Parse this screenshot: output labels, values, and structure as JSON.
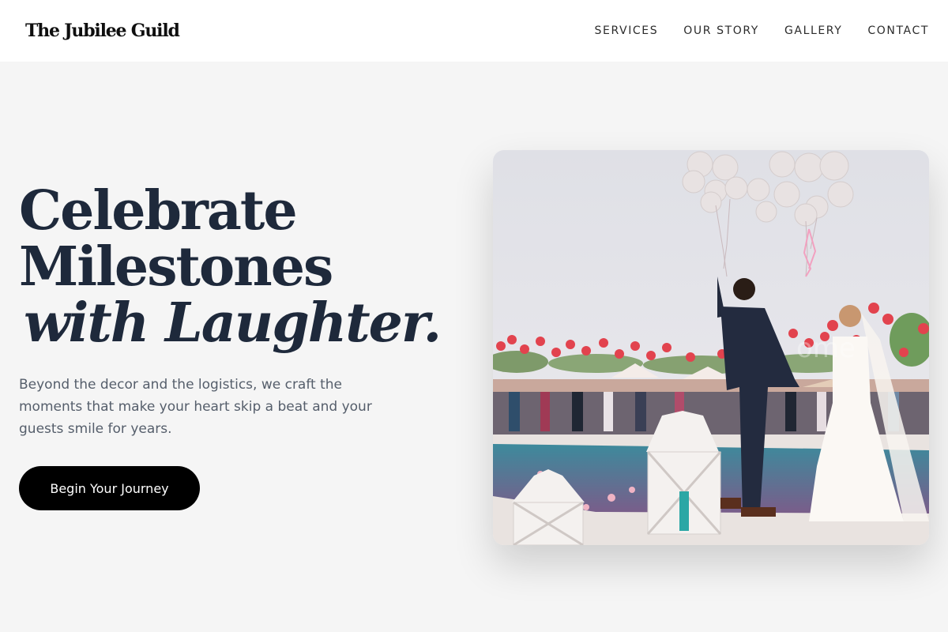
{
  "header": {
    "brand": "The Jubilee Guild",
    "nav": [
      "SERVICES",
      "OUR STORY",
      "GALLERY",
      "CONTACT"
    ]
  },
  "hero": {
    "headline_line1": "Celebrate",
    "headline_line2": "Milestones",
    "headline_line3": "with Laughter.",
    "subtext": "Beyond the decor and the logistics, we craft the moments that make your heart skip a beat and your guests smile for years.",
    "cta_label": "Begin Your Journey"
  },
  "colors": {
    "page_bg": "#f5f5f5",
    "headline": "#1e293b",
    "subtext": "#555e6b",
    "cta_bg": "#000000",
    "cta_text": "#ffffff"
  }
}
